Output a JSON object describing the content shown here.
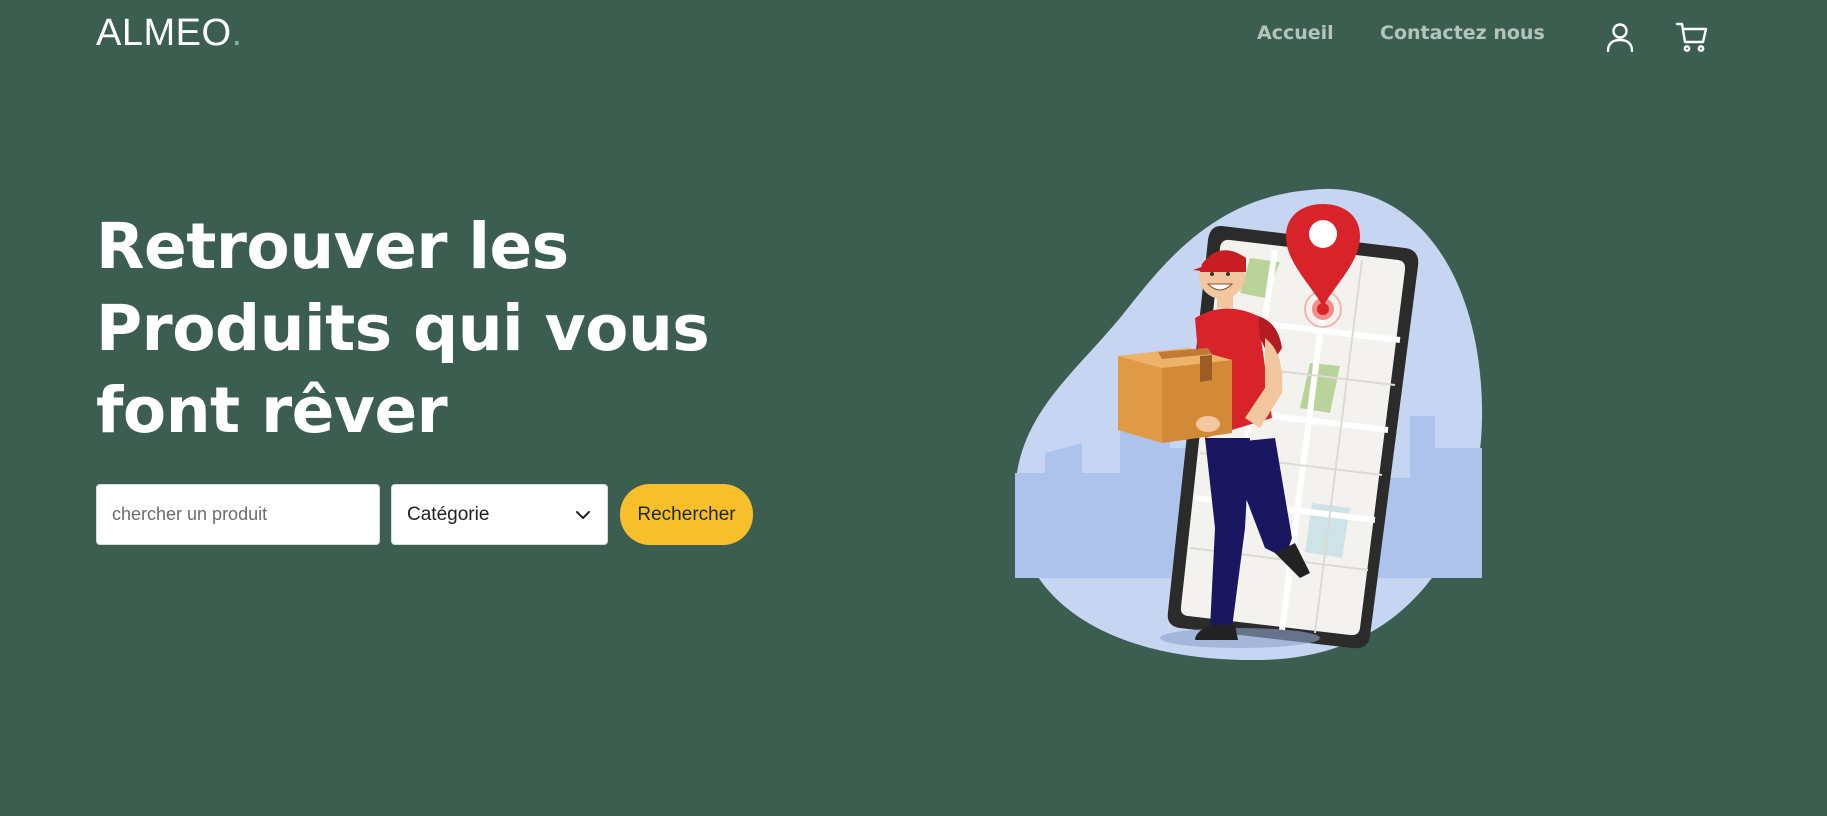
{
  "brand": {
    "name": "ALMEO",
    "dot": "."
  },
  "nav": {
    "links": [
      {
        "label": "Accueil"
      },
      {
        "label": "Contactez nous"
      }
    ],
    "icons": {
      "account": "user-icon",
      "cart": "shopping-cart-icon"
    }
  },
  "hero": {
    "title_lines": [
      "Retrouver les",
      "Produits qui vous",
      "font rêver"
    ]
  },
  "search": {
    "placeholder": "chercher un produit",
    "value": "",
    "category_selected": "Catégorie",
    "button_label": "Rechercher"
  },
  "colors": {
    "background": "#3c5e51",
    "accent": "#f8bf2c",
    "brand_dot": "#7fb08f",
    "nav_link": "#b3c4bc"
  }
}
